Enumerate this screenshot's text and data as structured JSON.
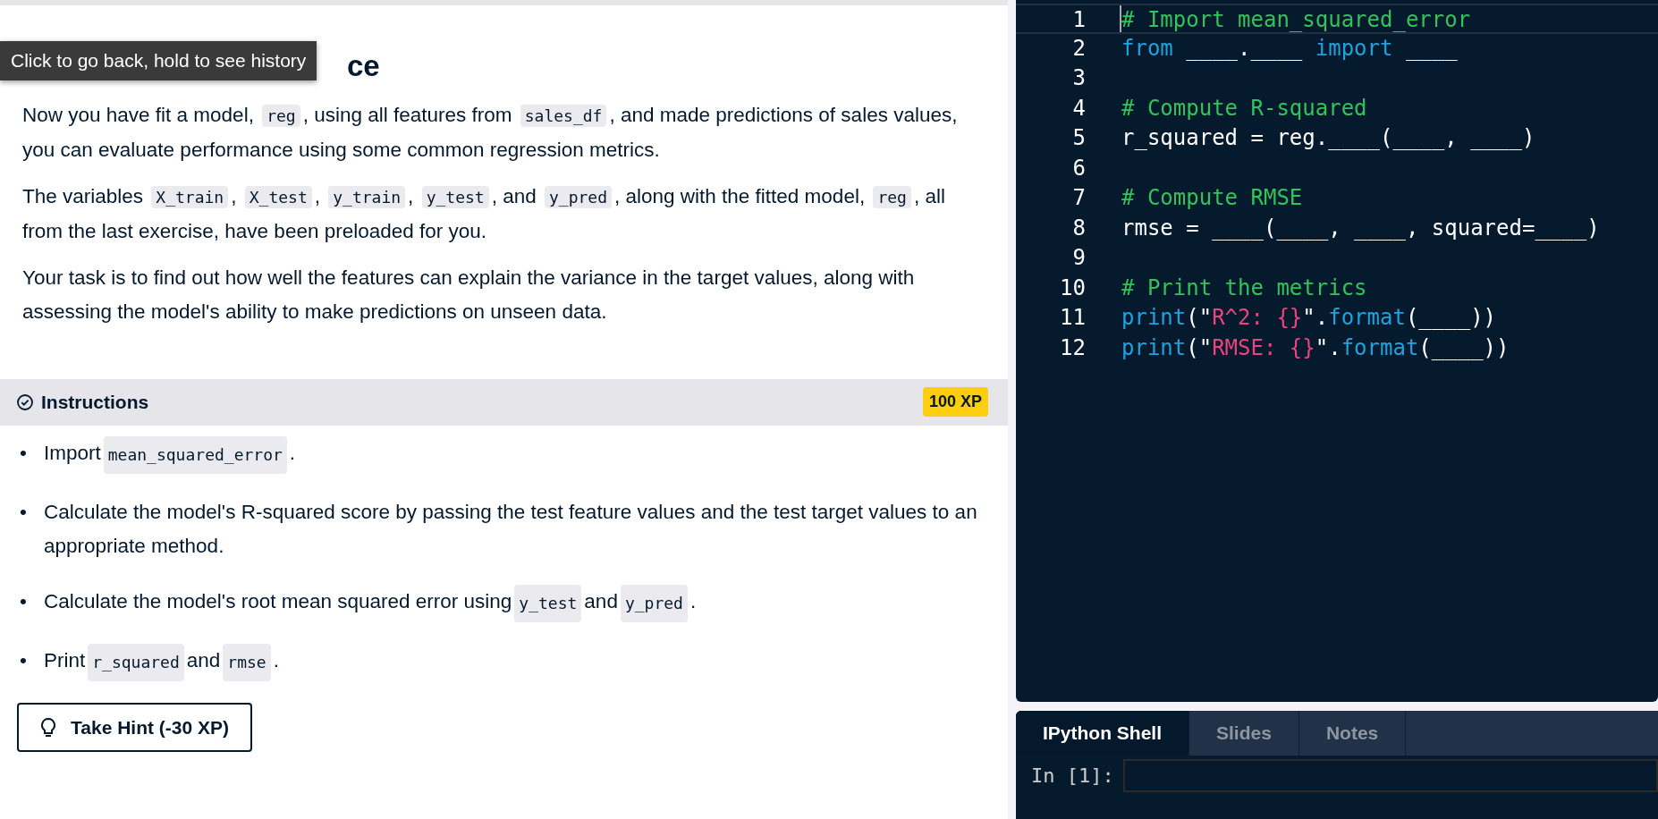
{
  "tooltip": "Click to go back, hold to see history",
  "exercise": {
    "title": "ce",
    "paragraphs": [
      [
        {
          "kind": "text",
          "text": "Now you have fit a model, "
        },
        {
          "kind": "code",
          "text": "reg"
        },
        {
          "kind": "text",
          "text": ", using all features from "
        },
        {
          "kind": "code",
          "text": "sales_df"
        },
        {
          "kind": "text",
          "text": ", and made predictions of sales values, you can evaluate performance using some common regression metrics."
        }
      ],
      [
        {
          "kind": "text",
          "text": "The variables "
        },
        {
          "kind": "code",
          "text": "X_train"
        },
        {
          "kind": "text",
          "text": ", "
        },
        {
          "kind": "code",
          "text": "X_test"
        },
        {
          "kind": "text",
          "text": ", "
        },
        {
          "kind": "code",
          "text": "y_train"
        },
        {
          "kind": "text",
          "text": ", "
        },
        {
          "kind": "code",
          "text": "y_test"
        },
        {
          "kind": "text",
          "text": ", and "
        },
        {
          "kind": "code",
          "text": "y_pred"
        },
        {
          "kind": "text",
          "text": ", along with the fitted model, "
        },
        {
          "kind": "code",
          "text": "reg"
        },
        {
          "kind": "text",
          "text": ", all from the last exercise, have been preloaded for you."
        }
      ],
      [
        {
          "kind": "text",
          "text": "Your task is to find out how well the features can explain the variance in the target values, along with assessing the model's ability to make predictions on unseen data."
        }
      ]
    ]
  },
  "instructions": {
    "label": "Instructions",
    "xp": "100 XP",
    "items": [
      [
        {
          "kind": "bullet",
          "text": "•"
        },
        {
          "kind": "text",
          "text": "Import "
        },
        {
          "kind": "code",
          "text": "mean_squared_error"
        },
        {
          "kind": "text",
          "text": "."
        }
      ],
      [
        {
          "kind": "bullet",
          "text": "•"
        },
        {
          "kind": "text",
          "text": "Calculate the model's R-squared score by passing the test feature values and the test target values to an appropriate method."
        }
      ],
      [
        {
          "kind": "bullet",
          "text": "•"
        },
        {
          "kind": "text",
          "text": "Calculate the model's root mean squared error using "
        },
        {
          "kind": "code",
          "text": "y_test"
        },
        {
          "kind": "text",
          "text": " and "
        },
        {
          "kind": "code",
          "text": "y_pred"
        },
        {
          "kind": "text",
          "text": "."
        }
      ],
      [
        {
          "kind": "bullet",
          "text": "•"
        },
        {
          "kind": "text",
          "text": "Print "
        },
        {
          "kind": "code",
          "text": "r_squared"
        },
        {
          "kind": "text",
          "text": " and "
        },
        {
          "kind": "code",
          "text": "rmse"
        },
        {
          "kind": "text",
          "text": "."
        }
      ]
    ],
    "hint_button": "Take Hint (-30 XP)"
  },
  "editor": {
    "lines": [
      {
        "number": "1",
        "current": true,
        "tokens": [
          {
            "kind": "comment",
            "text": "# Import mean_squared_error"
          }
        ]
      },
      {
        "number": "2",
        "current": false,
        "tokens": [
          {
            "kind": "keyword",
            "text": "from"
          },
          {
            "kind": "plain",
            "text": " ____.____ "
          },
          {
            "kind": "keyword",
            "text": "import"
          },
          {
            "kind": "plain",
            "text": " ____"
          }
        ]
      },
      {
        "number": "3",
        "current": false
      },
      {
        "number": "4",
        "current": false,
        "tokens": [
          {
            "kind": "comment",
            "text": "# Compute R-squared"
          }
        ]
      },
      {
        "number": "5",
        "current": false,
        "tokens": [
          {
            "kind": "plain",
            "text": "r_squared = reg.____(____, ____)"
          }
        ]
      },
      {
        "number": "6",
        "current": false
      },
      {
        "number": "7",
        "current": false,
        "tokens": [
          {
            "kind": "comment",
            "text": "# Compute RMSE"
          }
        ]
      },
      {
        "number": "8",
        "current": false,
        "tokens": [
          {
            "kind": "plain",
            "text": "rmse = ____(____, ____, squared=____)"
          }
        ]
      },
      {
        "number": "9",
        "current": false
      },
      {
        "number": "10",
        "current": false,
        "tokens": [
          {
            "kind": "comment",
            "text": "# Print the metrics"
          }
        ]
      },
      {
        "number": "11",
        "current": false,
        "tokens": [
          {
            "kind": "keyword",
            "text": "print"
          },
          {
            "kind": "plain",
            "text": "(\""
          },
          {
            "kind": "string",
            "text": "R^2: {}"
          },
          {
            "kind": "plain",
            "text": "\"."
          },
          {
            "kind": "keyword",
            "text": "format"
          },
          {
            "kind": "plain",
            "text": "(____))"
          }
        ]
      },
      {
        "number": "12",
        "current": false,
        "tokens": [
          {
            "kind": "keyword",
            "text": "print"
          },
          {
            "kind": "plain",
            "text": "(\""
          },
          {
            "kind": "string",
            "text": "RMSE: {}"
          },
          {
            "kind": "plain",
            "text": "\"."
          },
          {
            "kind": "keyword",
            "text": "format"
          },
          {
            "kind": "plain",
            "text": "(____))"
          }
        ]
      }
    ]
  },
  "shell": {
    "tabs": [
      {
        "label": "IPython Shell",
        "selected": true
      },
      {
        "label": "Slides",
        "selected": false
      },
      {
        "label": "Notes",
        "selected": false
      }
    ],
    "prompt": "In [1]:"
  }
}
